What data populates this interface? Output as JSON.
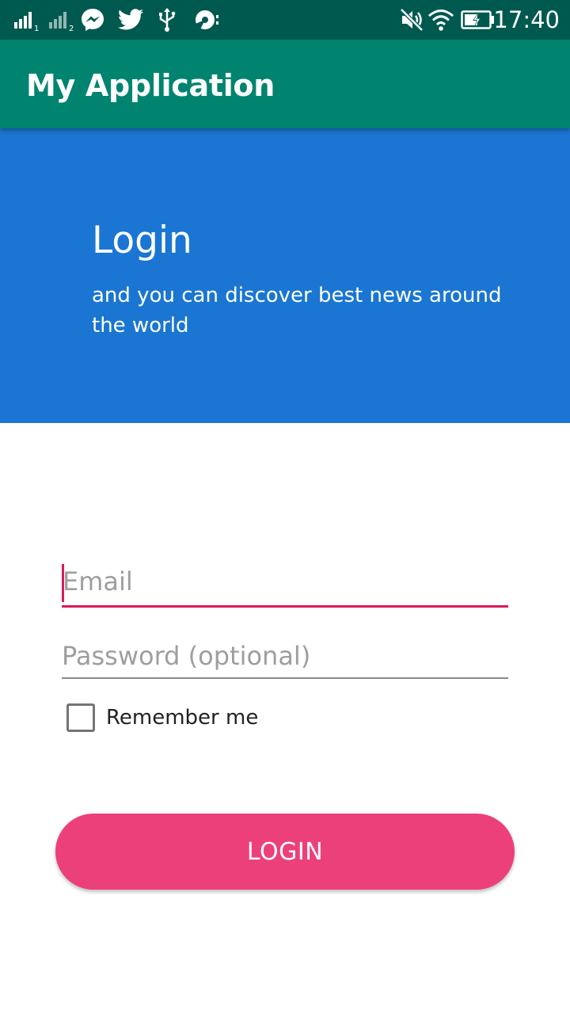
{
  "status_bar": {
    "time": "17:40",
    "icons": [
      "signal-sim1-icon",
      "signal-sim2-icon",
      "messenger-icon",
      "twitter-icon",
      "usb-icon",
      "sync-icon",
      "mute-icon",
      "wifi-icon",
      "battery-charging-icon"
    ],
    "sim1_label": "1",
    "sim2_label": "2"
  },
  "app_bar": {
    "title": "My Application"
  },
  "banner": {
    "title": "Login",
    "subtitle": "and you can discover best news around the world"
  },
  "form": {
    "email_placeholder": "Email",
    "email_value": "",
    "password_placeholder": "Password (optional)",
    "password_value": "",
    "remember_label": "Remember me",
    "remember_checked": false,
    "login_label": "LOGIN"
  },
  "colors": {
    "status_bar": "#00594f",
    "app_bar": "#00846f",
    "banner": "#1a76d2",
    "accent": "#d81b60",
    "button": "#ec407a"
  }
}
